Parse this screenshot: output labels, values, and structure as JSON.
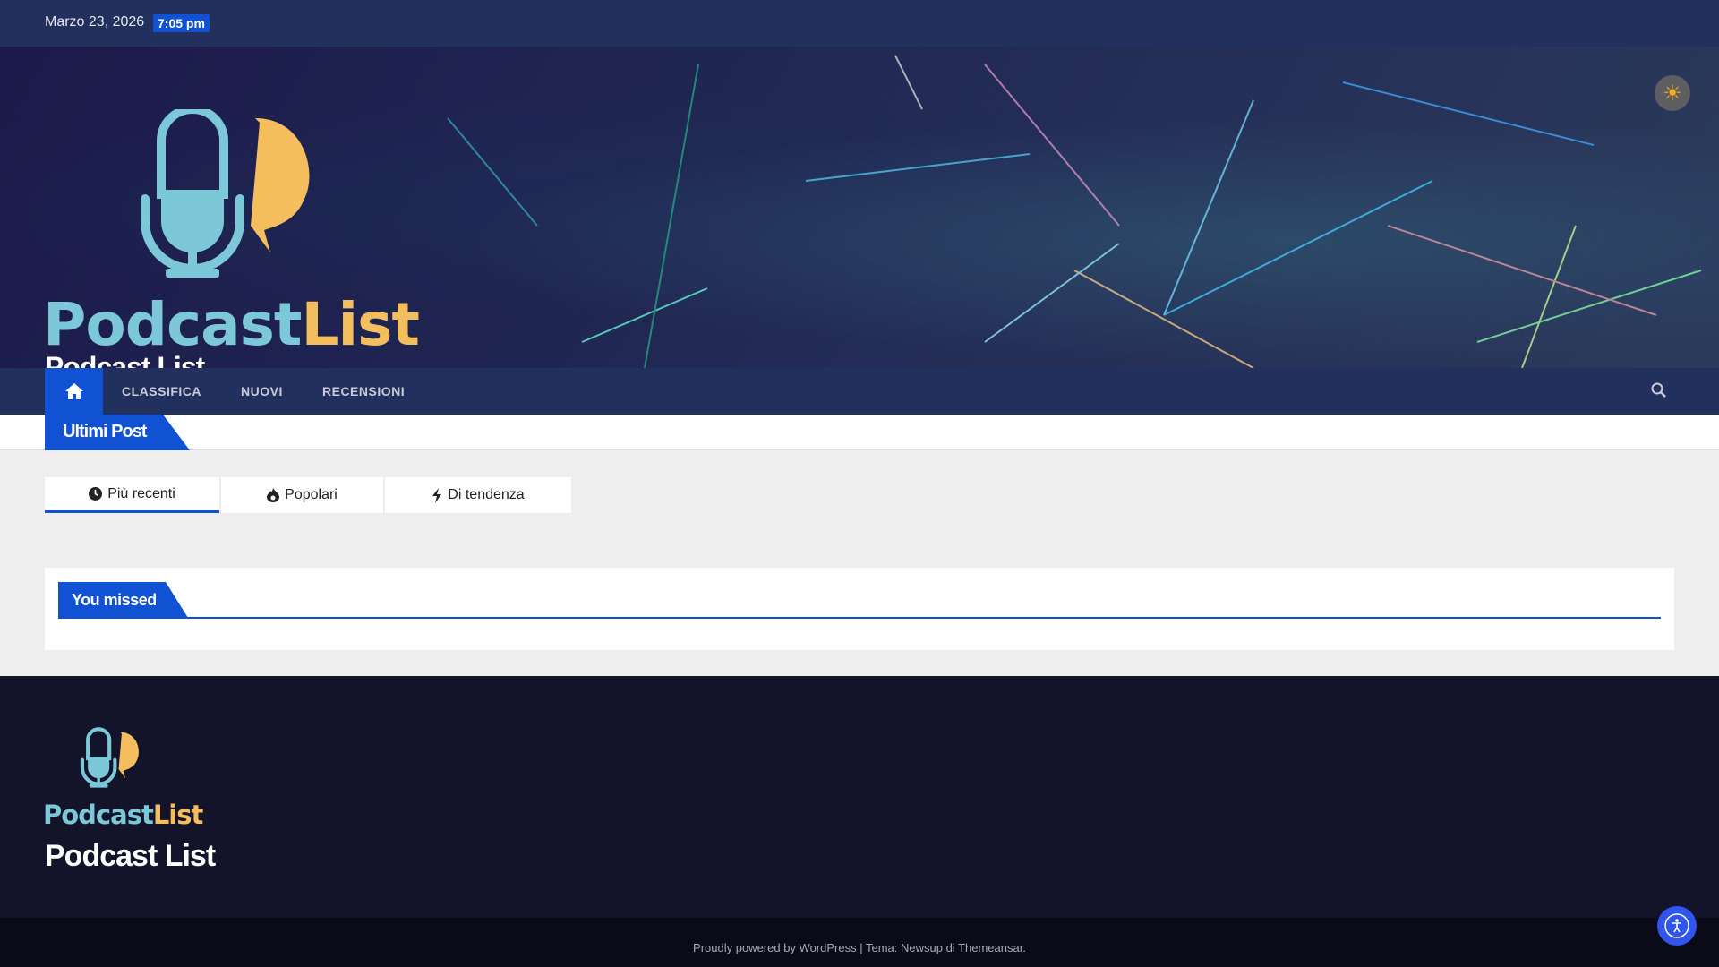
{
  "topbar": {
    "date": "Marzo 23, 2026",
    "time": "7:05 pm"
  },
  "header": {
    "logo_part1": "Podcast",
    "logo_part2": "List",
    "site_title": "Podcast List"
  },
  "nav": {
    "items": [
      {
        "label": "CLASSIFICA"
      },
      {
        "label": "NUOVI"
      },
      {
        "label": "RECENSIONI"
      }
    ]
  },
  "ticker": {
    "label": "Ultimi Post"
  },
  "tabs": [
    {
      "label": "Più recenti",
      "icon": "clock-icon"
    },
    {
      "label": "Popolari",
      "icon": "fire-icon"
    },
    {
      "label": "Di tendenza",
      "icon": "bolt-icon"
    }
  ],
  "missed": {
    "label": "You missed"
  },
  "footer": {
    "logo_part1": "Podcast",
    "logo_part2": "List",
    "site_title": "Podcast List"
  },
  "bottom": {
    "powered": "Proudly powered by WordPress",
    "sep": " | Tema: ",
    "theme": "Newsup",
    "by": " di ",
    "author": "Themeansar."
  },
  "colors": {
    "accent": "#1151d3",
    "navbar": "#22305d",
    "footer": "#13132a"
  }
}
